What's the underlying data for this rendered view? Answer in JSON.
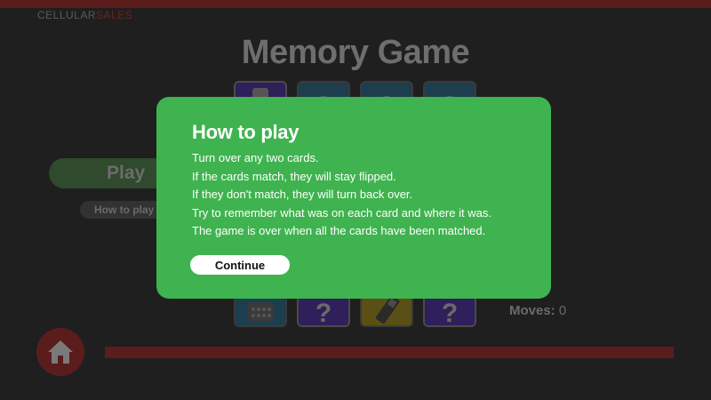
{
  "logo": {
    "part1": "CELLULAR",
    "part2": "SALES"
  },
  "title": "Memory Game",
  "buttons": {
    "play": "Play",
    "how_to_play": "How to play"
  },
  "cards": {
    "top": [
      {
        "face": "phone",
        "color": "#2f1f5a"
      },
      {
        "face": "?",
        "color": "#1d3e4e"
      },
      {
        "face": "?",
        "color": "#1d3e4e"
      },
      {
        "face": "?",
        "color": "#1d3e4e"
      }
    ],
    "bottom": [
      {
        "face": "phone",
        "color": "#1d3e4e"
      },
      {
        "face": "?",
        "color": "#2f1f5a"
      },
      {
        "face": "phone",
        "color": "#5a5016"
      },
      {
        "face": "?",
        "color": "#2f1f5a"
      }
    ]
  },
  "moves": {
    "label": "Moves:",
    "value": "0"
  },
  "modal": {
    "title": "How to play",
    "lines": [
      "Turn over any two cards.",
      "If the cards match, they will stay flipped.",
      "If they don't match, they will turn back over.",
      "Try to remember what was on each card and where it was.",
      "The game is over when all the cards have been matched."
    ],
    "continue_label": "Continue"
  },
  "colors": {
    "modal_bg": "#3fb34f",
    "accent_red": "#5a1d1c"
  },
  "icons": {
    "home": "home-icon",
    "question": "question-mark-icon"
  }
}
